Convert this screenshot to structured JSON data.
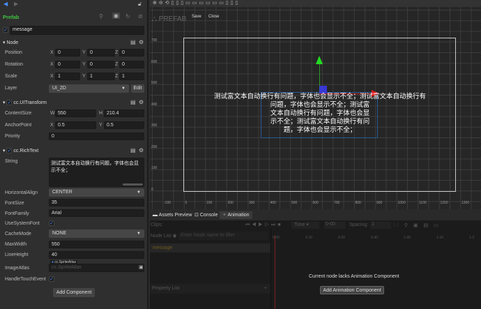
{
  "inspector": {
    "prefab_label": "Prefab",
    "node_name": "message",
    "node_section": "Node",
    "position": {
      "label": "Position",
      "x": "0",
      "y": "0",
      "z": "0"
    },
    "rotation": {
      "label": "Rotation",
      "x": "0",
      "y": "0",
      "z": "0"
    },
    "scale": {
      "label": "Scale",
      "x": "1",
      "y": "1",
      "z": "1"
    },
    "layer": {
      "label": "Layer",
      "value": "UI_2D",
      "edit": "Edit"
    },
    "uitransform": {
      "title": "cc.UITransform",
      "content_size": {
        "label": "ContentSize",
        "w": "550",
        "h": "210.4"
      },
      "anchor": {
        "label": "AnchorPoint",
        "x": "0.5",
        "y": "0.5"
      },
      "priority": {
        "label": "Priority",
        "value": "0"
      }
    },
    "richtext": {
      "title": "cc.RichText",
      "string_label": "String",
      "string_value": "测试富文本自动换行有问题，字体也会显示不全；",
      "halign": {
        "label": "HorizontalAlign",
        "value": "CENTER"
      },
      "font_size": {
        "label": "FontSize",
        "value": "35"
      },
      "font_family": {
        "label": "FontFamily",
        "value": "Arial"
      },
      "use_system_font": {
        "label": "UseSystemFont",
        "checked": true
      },
      "cache_mode": {
        "label": "CacheMode",
        "value": "NONE"
      },
      "max_width": {
        "label": "MaxWidth",
        "value": "550"
      },
      "line_height": {
        "label": "LineHeight",
        "value": "40"
      },
      "image_atlas": {
        "label": "ImageAtlas",
        "tag": "cc.SpriteAtlas",
        "placeholder": "cc.SpriteAtlas"
      },
      "handle_touch": {
        "label": "HandleTouchEvent",
        "checked": true
      }
    },
    "add_component": "Add Component",
    "axis": {
      "x": "X",
      "y": "Y",
      "z": "Z",
      "w": "W",
      "h": "H"
    }
  },
  "scene": {
    "prefab_title": "PREFAB",
    "save": "Save",
    "close": "Close",
    "y_ticks": [
      "700",
      "600",
      "500",
      "400",
      "300",
      "200",
      "100",
      "0"
    ],
    "x_ticks": [
      "-100",
      "0",
      "100",
      "200",
      "300",
      "400",
      "500",
      "600",
      "700",
      "800",
      "900",
      "1000",
      "1100",
      "1200",
      "1300"
    ],
    "rich_text_lines": [
      "测试富文本自动换行有问题，字体也会显示不全；测试富文本自动换行有",
      "问题，字体也会显示不全；测试富",
      "文本自动换行有问题，字体也会显",
      "示不全；测试富文本自动换行有问",
      "题，字体也会显示不全；"
    ]
  },
  "bottom": {
    "tabs": [
      "Assets Preview",
      "Console",
      "Animation"
    ],
    "clips_label": "Clips:",
    "time_label": "Time",
    "time_value": "0-00",
    "spacing_label": "Spacing:",
    "spacing_value": "1",
    "node_list_label": "Node List",
    "filter_placeholder": "Enter Node name to filter",
    "node_item": "message",
    "property_list": "Property List",
    "timeline_ticks": [
      "0-00",
      "0-10",
      "0-20",
      "0-30",
      "1-00",
      "1-10",
      "1-2"
    ],
    "empty_message": "Current node lacks Animation Component",
    "add_animation": "Add Animation Component"
  }
}
